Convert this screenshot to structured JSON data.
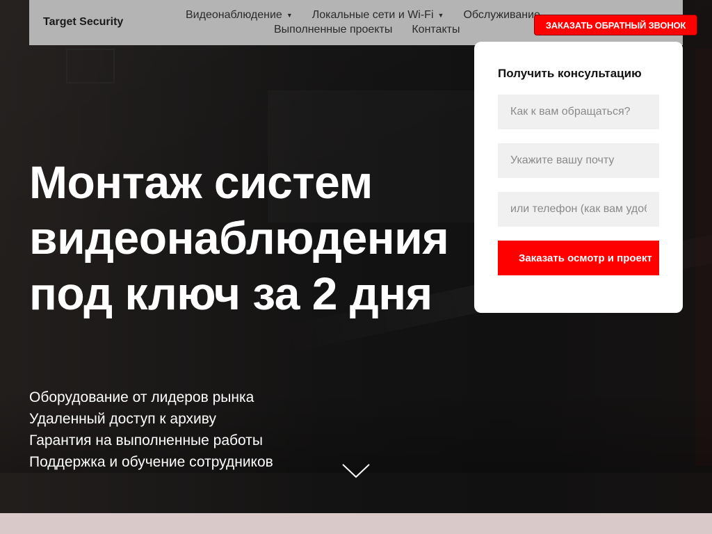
{
  "header": {
    "logo": "Target Security",
    "nav_row1": [
      {
        "label": "Видеонаблюдение",
        "has_dropdown": true
      },
      {
        "label": "Локальные сети и Wi-Fi",
        "has_dropdown": true
      },
      {
        "label": "Обслуживание",
        "has_dropdown": false
      }
    ],
    "nav_row2": [
      {
        "label": "Выполненные проекты",
        "has_dropdown": false
      },
      {
        "label": "Контакты",
        "has_dropdown": false
      }
    ],
    "caret_glyph": "▼",
    "callback_button": "Заказать обратный звонок"
  },
  "hero": {
    "title": "Монтаж систем видеонаблюдения под ключ за 2 дня",
    "features": [
      "Оборудование от лидеров рынка",
      "Удаленный доступ к архиву",
      "Гарантия на выполненные работы",
      "Поддержка и обучение сотрудников"
    ],
    "scroll_icon": "chevron-down-icon"
  },
  "form": {
    "title": "Получить консультацию",
    "name_placeholder": "Как к вам обращаться?",
    "email_placeholder": "Укажите вашу почту",
    "phone_placeholder": "или телефон (как вам удобнее)",
    "submit_label": "Заказать осмотр и проект"
  },
  "colors": {
    "accent": "#ff0000",
    "header_bg": "#b4b4b4",
    "hero_bg": "#141313",
    "input_bg": "#f0f0f0",
    "bottom_band": "#d9c9c9"
  }
}
